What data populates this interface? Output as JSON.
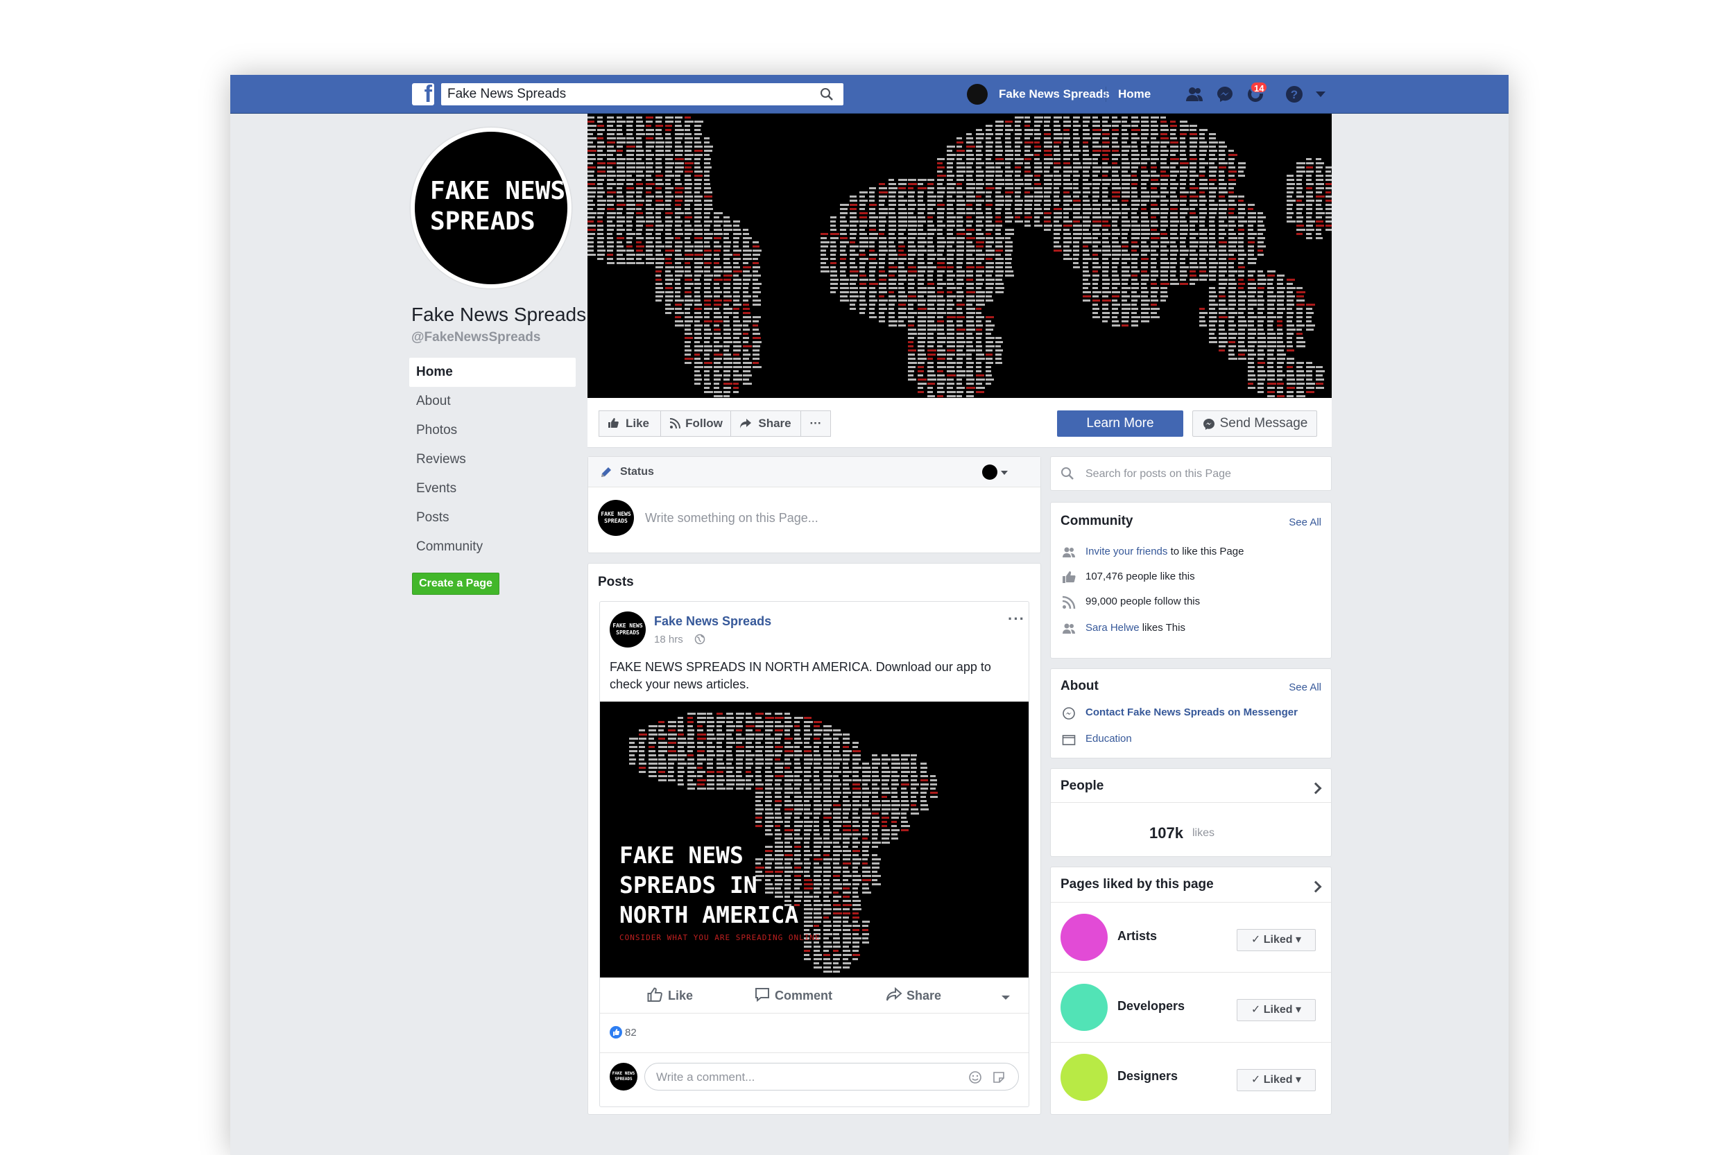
{
  "topbar": {
    "search_value": "Fake News Spreads",
    "profile_name": "Fake News Spreads",
    "home_label": "Home",
    "notification_count": "14",
    "brand_color": "#4267b2"
  },
  "page": {
    "logo_text": "FAKE NEWS\nSPREADS",
    "name": "Fake News Spreads",
    "handle": "@FakeNewsSpreads"
  },
  "leftnav": {
    "items": [
      "Home",
      "About",
      "Photos",
      "Reviews",
      "Events",
      "Posts",
      "Community"
    ],
    "create_page_label": "Create a Page"
  },
  "actionbar": {
    "like_label": "Like",
    "follow_label": "Follow",
    "share_label": "Share",
    "more_label": "···",
    "learn_more_label": "Learn More",
    "send_message_label": "Send Message"
  },
  "status": {
    "tab_label": "Status",
    "placeholder": "Write something on this Page..."
  },
  "posts": {
    "title": "Posts",
    "author": "Fake News Spreads",
    "time": "18 hrs",
    "text": "FAKE NEWS SPREADS IN NORTH AMERICA. Download our app to check your news articles.",
    "image_headline": "FAKE NEWS\nSPREADS IN\nNORTH AMERICA",
    "image_subline": "CONSIDER WHAT YOU ARE SPREADING ONLINE",
    "like_label": "Like",
    "comment_label": "Comment",
    "share_label": "Share",
    "reaction_count": "82",
    "comment_placeholder": "Write a comment..."
  },
  "right": {
    "search_placeholder": "Search for posts on this Page",
    "community": {
      "title": "Community",
      "see_all": "See All",
      "invite_link": "Invite your friends",
      "invite_rest": "to like this Page",
      "likes_text": "107,476 people like this",
      "follows_text": "99,000 people follow this",
      "friend_name": "Sara Helwe",
      "friend_rest": "likes This"
    },
    "about": {
      "title": "About",
      "see_all": "See All",
      "contact": "Contact Fake News Spreads on Messenger",
      "education": "Education"
    },
    "people": {
      "title": "People",
      "likes_count": "107k",
      "likes_word": "likes"
    },
    "pages_liked": {
      "title": "Pages liked by this page",
      "items": [
        {
          "name": "Artists",
          "color": "#e24bd6",
          "button": "Liked"
        },
        {
          "name": "Developers",
          "color": "#52e3b6",
          "button": "Liked"
        },
        {
          "name": "Designers",
          "color": "#b8ea45",
          "button": "Liked"
        }
      ]
    }
  }
}
